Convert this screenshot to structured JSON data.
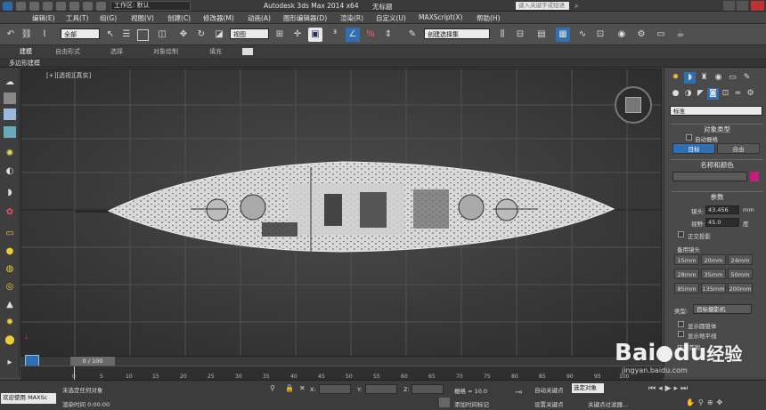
{
  "titlebar": {
    "workspace_label": "工作区: 默认",
    "app_title": "Autodesk 3ds Max  2014 x64",
    "doc_title": "无标题",
    "search_placeholder": "键入关键字或短语"
  },
  "menu": {
    "items": [
      "编辑(E)",
      "工具(T)",
      "组(G)",
      "视图(V)",
      "创建(C)",
      "修改器(M)",
      "动画(A)",
      "图形编辑器(D)",
      "渲染(R)",
      "自定义(U)",
      "MAXScript(X)",
      "帮助(H)"
    ]
  },
  "toolbar": {
    "selection_filter": "全部",
    "ref_coord": "视图",
    "named_selection": "创建选择集"
  },
  "ribbon": {
    "tabs": [
      "建模",
      "自由形式",
      "选择",
      "对象绘制",
      "填充"
    ],
    "sub_label": "多边形建模"
  },
  "viewport": {
    "label": "[+][透视][真实]"
  },
  "panel": {
    "category_dropdown": "标准",
    "object_type_header": "对象类型",
    "autogrid_label": "自动栅格",
    "btn_target": "目标",
    "btn_free": "自由",
    "name_color_header": "名称和颜色",
    "params_header": "参数",
    "lens_label": "镜头:",
    "lens_value": "43.456",
    "lens_unit": "mm",
    "fov_label": "视野:",
    "fov_value": "45.0",
    "fov_unit": "度",
    "ortho_label": "正交投影",
    "stock_lens_header": "备用镜头",
    "stock_lenses": [
      "15mm",
      "20mm",
      "24mm",
      "28mm",
      "35mm",
      "50mm",
      "85mm",
      "135mm",
      "200mm"
    ],
    "type_label": "类型:",
    "type_value": "目标摄影机",
    "show_cone_label": "显示圆锥体",
    "show_horizon_label": "显示地平线",
    "env_range_label": "环境范围"
  },
  "timeline": {
    "frame_label": "0 / 100",
    "ticks": [
      "0",
      "5",
      "10",
      "15",
      "20",
      "25",
      "30",
      "35",
      "40",
      "45",
      "50",
      "55",
      "60",
      "65",
      "70",
      "75",
      "80",
      "85",
      "90",
      "95",
      "100"
    ]
  },
  "status": {
    "welcome": "欢迎使用 MAXSc",
    "no_selection": "未选定任何对象",
    "render_time": "渲染时间 0:00:00",
    "x_label": "X:",
    "y_label": "Y:",
    "z_label": "Z:",
    "grid": "栅格 = 10.0",
    "add_time_tag": "添加时间标记",
    "auto_key": "自动关键点",
    "set_key": "设置关键点",
    "selected_obj": "选定对象",
    "key_filters": "关键点过滤器..."
  },
  "watermark": {
    "brand": "Bai",
    "brand2": "du",
    "suffix": "经验",
    "url": "jingyan.baidu.com"
  },
  "colors": {
    "accent_blue": "#2f6fb3",
    "swatch_magenta": "#c0207a",
    "watermark_red": "#d6262b"
  }
}
